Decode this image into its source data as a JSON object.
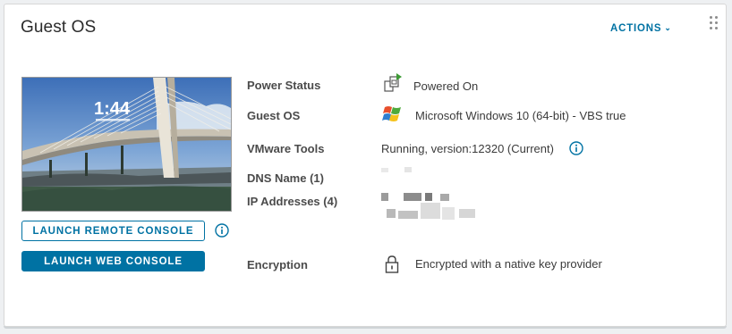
{
  "card": {
    "title": "Guest OS",
    "actions_label": "ACTIONS",
    "actions_chevron": "⌄"
  },
  "console": {
    "thumbnail_time": "1:44",
    "launch_remote_label": "LAUNCH REMOTE CONSOLE",
    "launch_web_label": "LAUNCH WEB CONSOLE"
  },
  "details": {
    "power_status": {
      "label": "Power Status",
      "value": "Powered On",
      "icon": "powered-on-icon"
    },
    "guest_os": {
      "label": "Guest OS",
      "value": "Microsoft Windows 10 (64-bit) - VBS true",
      "icon": "windows-logo-icon"
    },
    "vmware_tools": {
      "label": "VMware Tools",
      "value": "Running, version:12320 (Current)"
    },
    "dns_name": {
      "label": "DNS Name (1)"
    },
    "ip_addresses": {
      "label": "IP Addresses (4)"
    },
    "encryption": {
      "label": "Encryption",
      "value": "Encrypted with a native key provider",
      "icon": "lock-icon"
    }
  },
  "colors": {
    "accent": "#0072a3",
    "power_green": "#3d9b35"
  }
}
